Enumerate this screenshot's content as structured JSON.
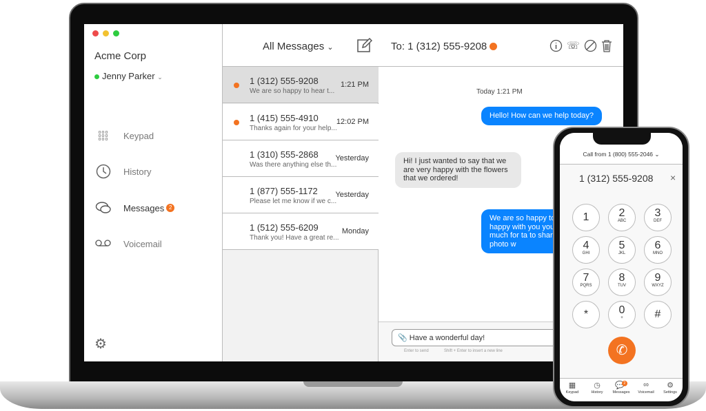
{
  "window": {
    "controls": [
      "close",
      "minimize",
      "maximize"
    ],
    "control_colors": [
      "#ee4b4b",
      "#f2c230",
      "#2ecc40"
    ]
  },
  "sidebar": {
    "company": "Acme Corp",
    "user": "Jenny Parker",
    "user_status_color": "#2ecc40",
    "items": [
      {
        "label": "Keypad",
        "icon": "keypad-icon"
      },
      {
        "label": "History",
        "icon": "clock-icon"
      },
      {
        "label": "Messages",
        "icon": "chat-bubbles-icon",
        "badge": "2"
      },
      {
        "label": "Voicemail",
        "icon": "voicemail-icon"
      }
    ],
    "settings_icon": "gear-icon"
  },
  "header": {
    "filter": "All Messages",
    "to": "To: 1 (312) 555-9208",
    "actions": [
      "info-icon",
      "phone-icon",
      "block-icon",
      "trash-icon"
    ]
  },
  "conversations": [
    {
      "phone": "1 (312) 555-9208",
      "preview": "We are so happy to hear t...",
      "time": "1:21 PM",
      "unread": true,
      "selected": true
    },
    {
      "phone": "1 (415) 555-4910",
      "preview": "Thanks again for your help...",
      "time": "12:02 PM",
      "unread": true
    },
    {
      "phone": "1 (310) 555-2868",
      "preview": "Was there anything else th...",
      "time": "Yesterday"
    },
    {
      "phone": "1 (877) 555-1172",
      "preview": "Please let me know if we c...",
      "time": "Yesterday"
    },
    {
      "phone": "1 (512) 555-6209",
      "preview": "Thank you! Have a great re...",
      "time": "Monday"
    }
  ],
  "chat": {
    "timestamp": "Today 1:21 PM",
    "messages": [
      {
        "dir": "out",
        "text": "Hello! How can we help today?"
      },
      {
        "dir": "in",
        "text": "Hi! I just wanted to say that we are very happy with the flowers that we ordered!"
      },
      {
        "dir": "out",
        "text": "We are so happy to are happy with you you so much for ta to share a photo w"
      }
    ],
    "compose_value": "Have a wonderful day!",
    "hint_send": "Enter to send",
    "hint_newline": "Shift + Enter to insert a new line"
  },
  "accent": "#f37321",
  "bubble_blue": "#0a84ff",
  "phone": {
    "caller_id": "Call from 1 (800) 555-2046",
    "dialed": "1 (312) 555-9208",
    "keys": [
      {
        "d": "1",
        "l": ""
      },
      {
        "d": "2",
        "l": "ABC"
      },
      {
        "d": "3",
        "l": "DEF"
      },
      {
        "d": "4",
        "l": "GHI"
      },
      {
        "d": "5",
        "l": "JKL"
      },
      {
        "d": "6",
        "l": "MNO"
      },
      {
        "d": "7",
        "l": "PQRS"
      },
      {
        "d": "8",
        "l": "TUV"
      },
      {
        "d": "9",
        "l": "WXYZ"
      },
      {
        "d": "*",
        "l": ""
      },
      {
        "d": "0",
        "l": "+"
      },
      {
        "d": "#",
        "l": ""
      }
    ],
    "tabs": [
      {
        "label": "Keypad"
      },
      {
        "label": "History"
      },
      {
        "label": "Messages",
        "badge": "2"
      },
      {
        "label": "Voicemail"
      },
      {
        "label": "Settings"
      }
    ]
  }
}
